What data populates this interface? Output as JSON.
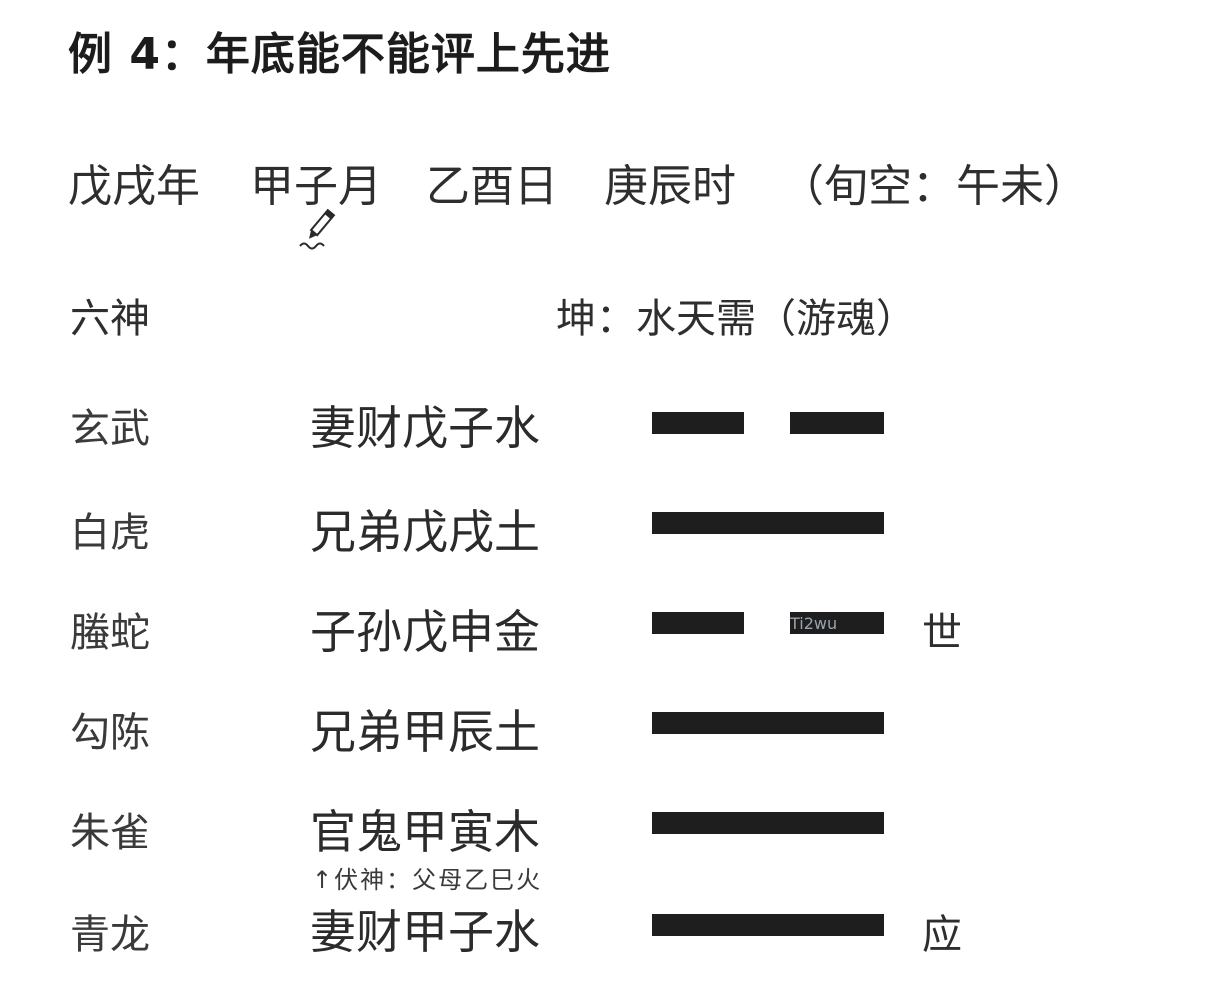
{
  "title": "例 4：年底能不能评上先进",
  "dates": {
    "year": "戊戌年",
    "month": "甲子月",
    "day": "乙酉日",
    "hour": "庚辰时",
    "void": "（旬空：午未）"
  },
  "header": {
    "six_spirits": "六神",
    "hexagram": "坤：水天需（游魂）"
  },
  "lines": [
    {
      "spirit": "玄武",
      "label": "妻财戊子水",
      "type": "yin",
      "mark": ""
    },
    {
      "spirit": "白虎",
      "label": "兄弟戊戌土",
      "type": "yang",
      "mark": ""
    },
    {
      "spirit": "螣蛇",
      "label": "子孙戊申金",
      "type": "yin",
      "mark": "世"
    },
    {
      "spirit": "勾陈",
      "label": "兄弟甲辰土",
      "type": "yang",
      "mark": ""
    },
    {
      "spirit": "朱雀",
      "label": "官鬼甲寅木",
      "type": "yang",
      "mark": ""
    },
    {
      "spirit": "青龙",
      "label": "妻财甲子水",
      "type": "yang",
      "mark": "应"
    }
  ],
  "hidden_spirit": "↑伏神：父母乙巳火",
  "watermark": "Ti2wu",
  "icons": {
    "pen": "pen-cursor-icon"
  }
}
